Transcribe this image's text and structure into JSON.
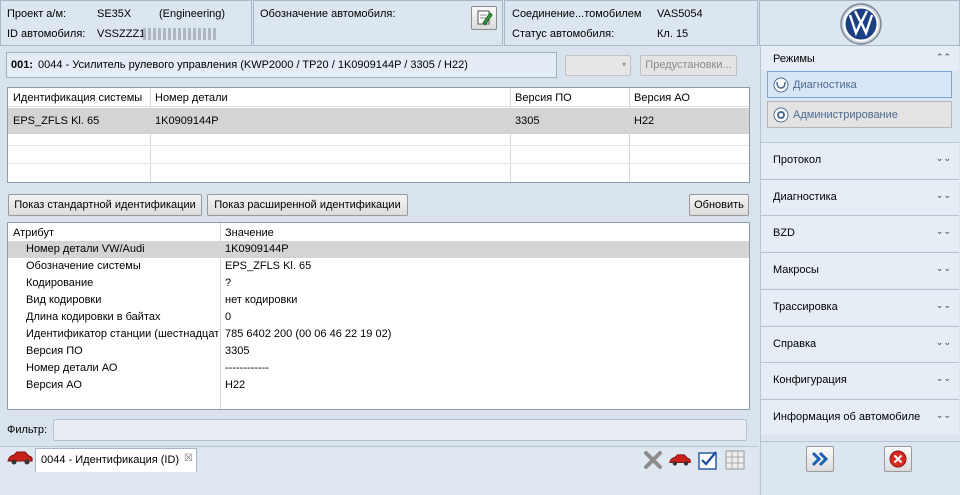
{
  "header": {
    "project_label": "Проект а/м:",
    "project_value": "SE35X",
    "project_mode": "(Engineering)",
    "vin_label": "ID автомобиля:",
    "vin_value": "VSSZZZ1",
    "designation_label": "Обозначение автомобиля:",
    "connection_label": "Соединение...томобилем",
    "connection_value": "VAS5054",
    "status_label": "Статус автомобиля:",
    "status_value": "Кл. 15"
  },
  "module": {
    "title_bold": "001:",
    "title_text": "0044 - Усилитель рулевого управления  (KWP2000 / TP20 / 1K0909144P   / 3305 / H22)",
    "preset_button": "Предустановки..."
  },
  "sys_table": {
    "columns": [
      "Идентификация системы",
      "Номер детали",
      "Версия ПО",
      "Версия АО"
    ],
    "rows": [
      [
        "EPS_ZFLS Kl. 65",
        "1K0909144P",
        "3305",
        "H22"
      ]
    ]
  },
  "buttons": {
    "std_ident": "Показ стандартной идентификации",
    "ext_ident": "Показ расширенной идентификации",
    "refresh": "Обновить"
  },
  "attr_table": {
    "columns": [
      "Атрибут",
      "Значение"
    ],
    "rows": [
      [
        "Номер детали VW/Audi",
        "1K0909144P"
      ],
      [
        "Обозначение системы",
        "EPS_ZFLS Kl. 65"
      ],
      [
        "Кодирование",
        "?"
      ],
      [
        "Вид кодировки",
        "нет кодировки"
      ],
      [
        "Длина кодировки в байтах",
        "0"
      ],
      [
        "Идентификатор станции (шестнадцатеричный)",
        "785 6402 200 (00 06 46 22 19 02)"
      ],
      [
        "Версия ПО",
        "3305"
      ],
      [
        "Номер детали АО",
        "------------"
      ],
      [
        "Версия АО",
        "H22"
      ]
    ]
  },
  "filter": {
    "label": "Фильтр:",
    "value": ""
  },
  "bottom_tab": {
    "label": "0044 - Идентификация (ID)",
    "close": "☒"
  },
  "sidebar": {
    "modes_title": "Режимы",
    "modes": [
      "Диагностика",
      "Администрирование"
    ],
    "sections": [
      "Протокол",
      "Диагностика",
      "BZD",
      "Макросы",
      "Трассировка",
      "Справка",
      "Конфигурация",
      "Информация об автомобиле"
    ]
  },
  "colors": {
    "accent": "#1a5fb4",
    "selected_row": "#d4d4d4",
    "close_red": "#d82a1e"
  },
  "icons": [
    "edit-icon",
    "vw-logo",
    "car-icon",
    "tools-icon",
    "checklist-icon",
    "grid-icon",
    "forward-icon",
    "close-icon"
  ]
}
